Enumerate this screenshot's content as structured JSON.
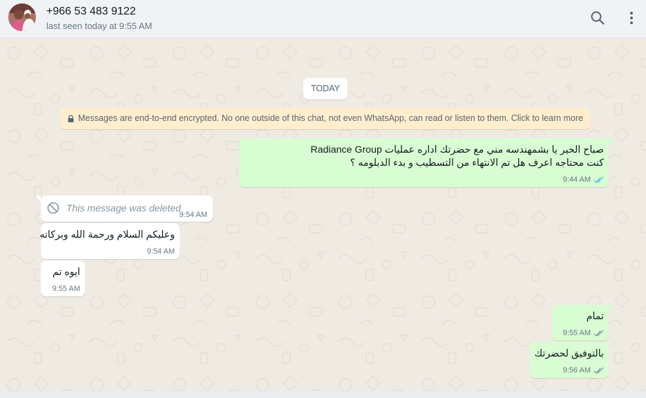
{
  "header": {
    "contact_name": "+966 53 483 9122",
    "status": "last seen today at 9:55 AM",
    "icons": [
      "avatar",
      "search-icon",
      "menu-icon"
    ]
  },
  "chat": {
    "date_chip": "TODAY",
    "encryption_notice": "Messages are end-to-end encrypted. No one outside of this chat, not even WhatsApp, can read or listen to them. Click to learn more",
    "messages": [
      {
        "direction": "out",
        "lines": [
          "صباح الخير يا بشمهندسه مني مع حضرتك اداره عمليات Radiance Group",
          "كنت محتاجه اعرف هل تم الانتهاء من التسطيب و بدء الدبلومه ؟"
        ],
        "time": "9:44 AM",
        "status": "read"
      },
      {
        "direction": "in",
        "deleted": true,
        "text": "This message was deleted",
        "time": "9:54 AM"
      },
      {
        "direction": "in",
        "lines": [
          "وعليكم السلام ورحمة الله وبركاته"
        ],
        "time": "9:54 AM"
      },
      {
        "direction": "in",
        "lines": [
          "ايوه تم"
        ],
        "time": "9:55 AM"
      },
      {
        "direction": "out",
        "lines": [
          "تمام"
        ],
        "time": "9:55 AM",
        "status": "delivered"
      },
      {
        "direction": "out",
        "lines": [
          "بالتوفيق لحضرتك"
        ],
        "time": "9:56 AM",
        "status": "delivered"
      }
    ]
  },
  "colors": {
    "outgoing_bubble": "#d9fdd3",
    "incoming_bubble": "#ffffff",
    "chat_background": "#efeae2",
    "read_tick": "#53bdeb",
    "delivered_tick": "#8696a0",
    "encryption_banner": "#ffeecd"
  }
}
